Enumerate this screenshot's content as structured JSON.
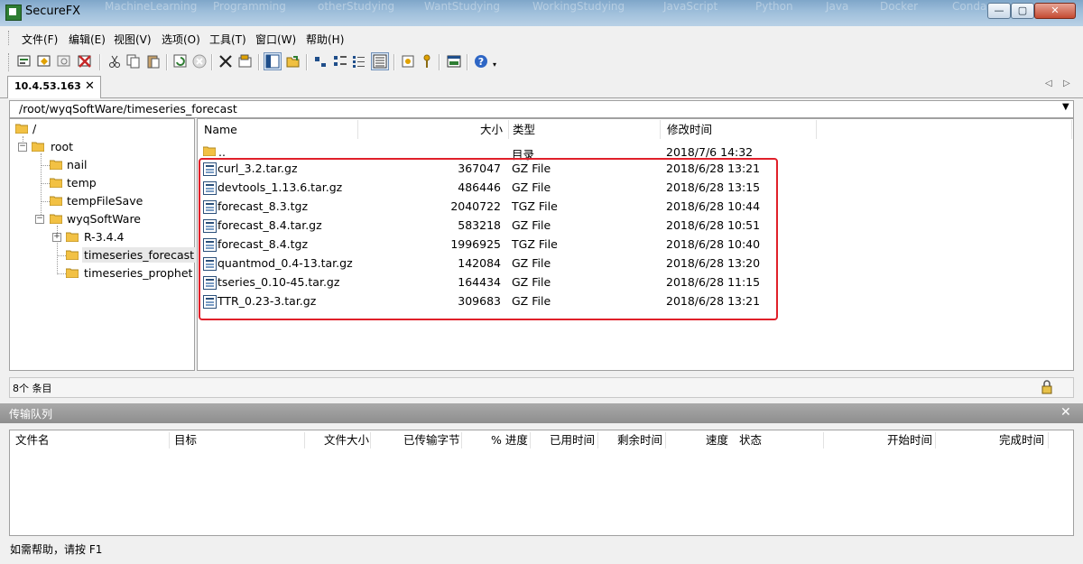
{
  "window": {
    "title": "SecureFX",
    "background_tabs": [
      "MachineLearning",
      "Programming",
      "otherStudying",
      "WantStudying",
      "WorkingStudying",
      "JavaScript",
      "Python",
      "Java",
      "Docker",
      "Conda"
    ]
  },
  "menu": [
    "文件(F)",
    "编辑(E)",
    "视图(V)",
    "选项(O)",
    "工具(T)",
    "窗口(W)",
    "帮助(H)"
  ],
  "session_tab": {
    "label": "10.4.53.163",
    "close": "✕"
  },
  "path": "/root/wyqSoftWare/timeseries_forecast",
  "tree": [
    {
      "label": "/"
    },
    {
      "label": "root",
      "expander": "−"
    },
    {
      "label": "nail"
    },
    {
      "label": "temp"
    },
    {
      "label": "tempFileSave"
    },
    {
      "label": "wyqSoftWare",
      "expander": "−"
    },
    {
      "label": "R-3.4.4",
      "expander": "+"
    },
    {
      "label": "timeseries_forecast",
      "selected": true
    },
    {
      "label": "timeseries_prophet"
    }
  ],
  "list": {
    "columns": {
      "name": "Name",
      "size": "大小",
      "type": "类型",
      "modified": "修改时间"
    },
    "parent": {
      "name": "..",
      "type": "目录",
      "modified": "2018/7/6 14:32"
    },
    "files": [
      {
        "name": "curl_3.2.tar.gz",
        "size": "367047",
        "type": "GZ File",
        "modified": "2018/6/28 13:21"
      },
      {
        "name": "devtools_1.13.6.tar.gz",
        "size": "486446",
        "type": "GZ File",
        "modified": "2018/6/28 13:15"
      },
      {
        "name": "forecast_8.3.tgz",
        "size": "2040722",
        "type": "TGZ File",
        "modified": "2018/6/28 10:44"
      },
      {
        "name": "forecast_8.4.tar.gz",
        "size": "583218",
        "type": "GZ File",
        "modified": "2018/6/28 10:51"
      },
      {
        "name": "forecast_8.4.tgz",
        "size": "1996925",
        "type": "TGZ File",
        "modified": "2018/6/28 10:40"
      },
      {
        "name": "quantmod_0.4-13.tar.gz",
        "size": "142084",
        "type": "GZ File",
        "modified": "2018/6/28 13:20"
      },
      {
        "name": "tseries_0.10-45.tar.gz",
        "size": "164434",
        "type": "GZ File",
        "modified": "2018/6/28 11:15"
      },
      {
        "name": "TTR_0.23-3.tar.gz",
        "size": "309683",
        "type": "GZ File",
        "modified": "2018/6/28 13:21"
      }
    ],
    "highlight_color": "#e0202a"
  },
  "status": {
    "item_count": "8个 条目"
  },
  "queue": {
    "title": "传输队列",
    "columns": [
      "文件名",
      "目标",
      "文件大小",
      "已传输字节",
      "% 进度",
      "已用时间",
      "剩余时间",
      "速度",
      "状态",
      "开始时间",
      "完成时间"
    ]
  },
  "bottom_status": "如需帮助，请按 F1"
}
